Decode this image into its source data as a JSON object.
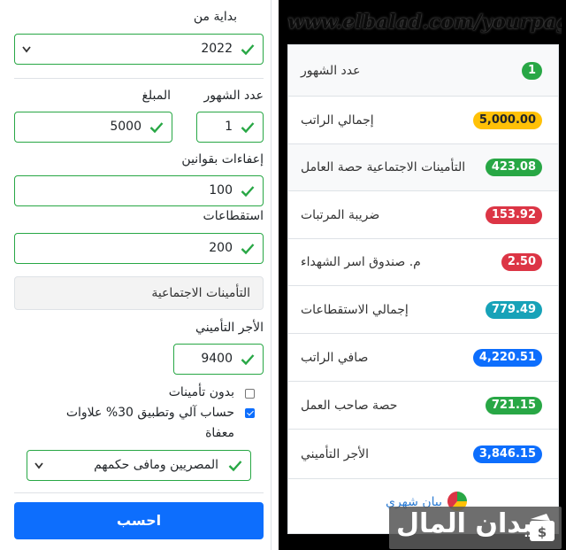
{
  "site": {
    "url": "www.elbalad.com/yourpage"
  },
  "form": {
    "start_label": "بداية من",
    "start_value": "2022",
    "months_label": "عدد الشهور",
    "months_value": "1",
    "amount_label": "المبلغ",
    "amount_value": "5000",
    "exempt_label": "إعفاءات بقوانين",
    "exempt_value": "100",
    "deductions_label": "استقطاعات",
    "deductions_value": "200",
    "social_button": "التأمينات الاجتماعية",
    "insurable_label": "الأجر التأميني",
    "insurable_value": "9400",
    "no_insurance_label": "بدون تأمينات",
    "auto_calc_label": "حساب آلي وتطبيق 30% علاوات",
    "auto_calc_label2": "معفاة",
    "select_value": "المصريين ومافى حكمهم",
    "calc_button": "احسب"
  },
  "results": {
    "rows": [
      {
        "label": "عدد الشهور",
        "value": "1"
      },
      {
        "label": "إجمالي الراتب",
        "value": "5,000.00"
      },
      {
        "label": "التأمينات الاجتماعية حصة العامل",
        "value": "423.08"
      },
      {
        "label": "ضريبة المرتبات",
        "value": "153.92"
      },
      {
        "label": "م. صندوق اسر الشهداء",
        "value": "2.50"
      },
      {
        "label": "إجمالي الاستقطاعات",
        "value": "779.49"
      },
      {
        "label": "صافي الراتب",
        "value": "4,220.51"
      },
      {
        "label": "حصة صاحب العمل",
        "value": "721.15"
      },
      {
        "label": "الأجر التأميني",
        "value": "3,846.15"
      }
    ],
    "chart_link": "بيان شهري"
  },
  "watermark": {
    "text": "ميدان المال"
  },
  "colors": {
    "green": "#28a745",
    "yellow": "#ffc107",
    "red": "#dc3545",
    "teal": "#17a2b8",
    "blue": "#0d6efd"
  },
  "icons": {
    "check": "check-icon",
    "chevron": "chevron-down-icon",
    "pie": "pie-chart-icon",
    "logo": "wallet-icon"
  }
}
